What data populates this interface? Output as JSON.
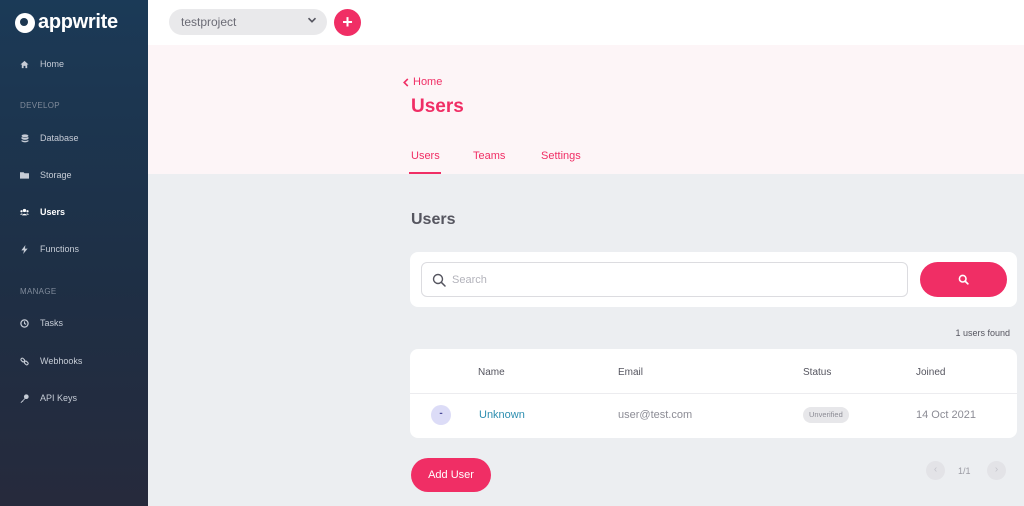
{
  "brand": {
    "name": "appwrite",
    "accent": "#f02e65"
  },
  "sidebar": {
    "items_top": [
      {
        "label": "Home",
        "icon": "home-icon"
      }
    ],
    "section_develop": "DEVELOP",
    "items_develop": [
      {
        "label": "Database",
        "icon": "database-icon"
      },
      {
        "label": "Storage",
        "icon": "folder-icon"
      },
      {
        "label": "Users",
        "icon": "users-icon",
        "active": true
      },
      {
        "label": "Functions",
        "icon": "bolt-icon"
      }
    ],
    "section_manage": "MANAGE",
    "items_manage": [
      {
        "label": "Tasks",
        "icon": "clock-icon"
      },
      {
        "label": "Webhooks",
        "icon": "link-icon"
      },
      {
        "label": "API Keys",
        "icon": "key-icon"
      }
    ]
  },
  "topbar": {
    "project": "testproject",
    "add_label": "+"
  },
  "header": {
    "breadcrumb": "Home",
    "title": "Users",
    "tabs": [
      {
        "label": "Users",
        "active": true
      },
      {
        "label": "Teams"
      },
      {
        "label": "Settings"
      }
    ]
  },
  "main": {
    "section_title": "Users",
    "search": {
      "placeholder": "Search"
    },
    "count_text": "1 users found",
    "table": {
      "columns": [
        "Name",
        "Email",
        "Status",
        "Joined"
      ],
      "rows": [
        {
          "avatar": "-",
          "name": "Unknown",
          "email": "user@test.com",
          "status": "Unverified",
          "joined": "14 Oct 2021"
        }
      ]
    },
    "add_user_label": "Add User",
    "pagination": {
      "indicator": "1/1",
      "prev": "‹",
      "next": "›"
    }
  }
}
